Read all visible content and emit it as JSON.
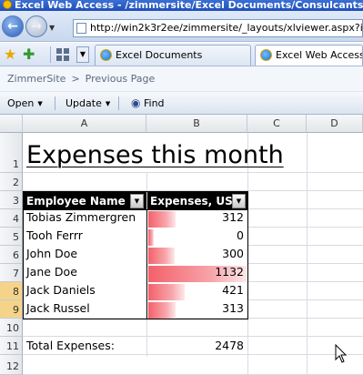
{
  "window": {
    "title": "Excel Web Access - /zimmersite/Excel Documents/Consulcants Exp"
  },
  "browser": {
    "address": "http://win2k3r2ee/zimmersite/_layouts/xlviewer.aspx?id=/zim",
    "tabs": [
      {
        "label": "Excel Documents",
        "icon": "ie-page-icon"
      },
      {
        "label": "Excel Web Access",
        "icon": "ie-page-icon"
      }
    ]
  },
  "breadcrumb": {
    "site": "ZimmerSite",
    "separator": ">",
    "page": "Previous Page"
  },
  "toolbar": {
    "open_label": "Open",
    "update_label": "Update",
    "find_label": "Find"
  },
  "sheet": {
    "columns": [
      "A",
      "B",
      "C",
      "D"
    ],
    "rows": [
      "1",
      "2",
      "3",
      "4",
      "5",
      "6",
      "7",
      "8",
      "9",
      "10",
      "11",
      "12"
    ],
    "selected_rows": [
      "8",
      "9"
    ],
    "title": "Expenses this month",
    "header": {
      "employee": "Employee Name",
      "expenses": "Expenses, USD"
    },
    "data": [
      {
        "name": "Tobias Zimmergren",
        "value": "312",
        "amount": 312
      },
      {
        "name": "Tooh Ferrr",
        "value": "0",
        "amount": 0
      },
      {
        "name": "John Doe",
        "value": "300",
        "amount": 300
      },
      {
        "name": "Jane Doe",
        "value": "1132",
        "amount": 1132
      },
      {
        "name": "Jack Daniels",
        "value": "421",
        "amount": 421
      },
      {
        "name": "Jack Russel",
        "value": "313",
        "amount": 313
      }
    ],
    "total_label": "Total Expenses:",
    "total_value": "2478",
    "databar_color": "#f4606a"
  }
}
